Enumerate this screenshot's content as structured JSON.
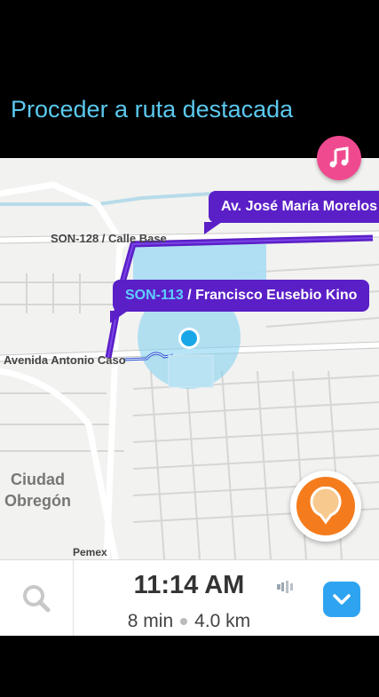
{
  "header": {
    "title": "Proceder a ruta destacada"
  },
  "map": {
    "streets": {
      "son128": "SON-128 / Calle Base",
      "caso": "Avenida Antonio Caso",
      "pemex": "Pemex"
    },
    "city": {
      "line1": "Ciudad",
      "line2": "Obregón"
    },
    "callouts": {
      "morelos": "Av. José María Morelos",
      "son113_prefix": "SON-113",
      "son113_rest": " / Francisco Eusebio Kino"
    }
  },
  "bottom_bar": {
    "eta_time": "11:14 AM",
    "duration": "8 min",
    "distance": "4.0 km"
  },
  "icons": {
    "music": "music-note-icon",
    "search": "search-icon",
    "volume": "volume-icon",
    "chevron": "chevron-down-icon",
    "report": "report-icon",
    "location": "current-location-icon"
  },
  "colors": {
    "route": "#5b1fc7",
    "accent_blue": "#5bc8ee",
    "music": "#ef4a8f",
    "report": "#f47c1d"
  }
}
